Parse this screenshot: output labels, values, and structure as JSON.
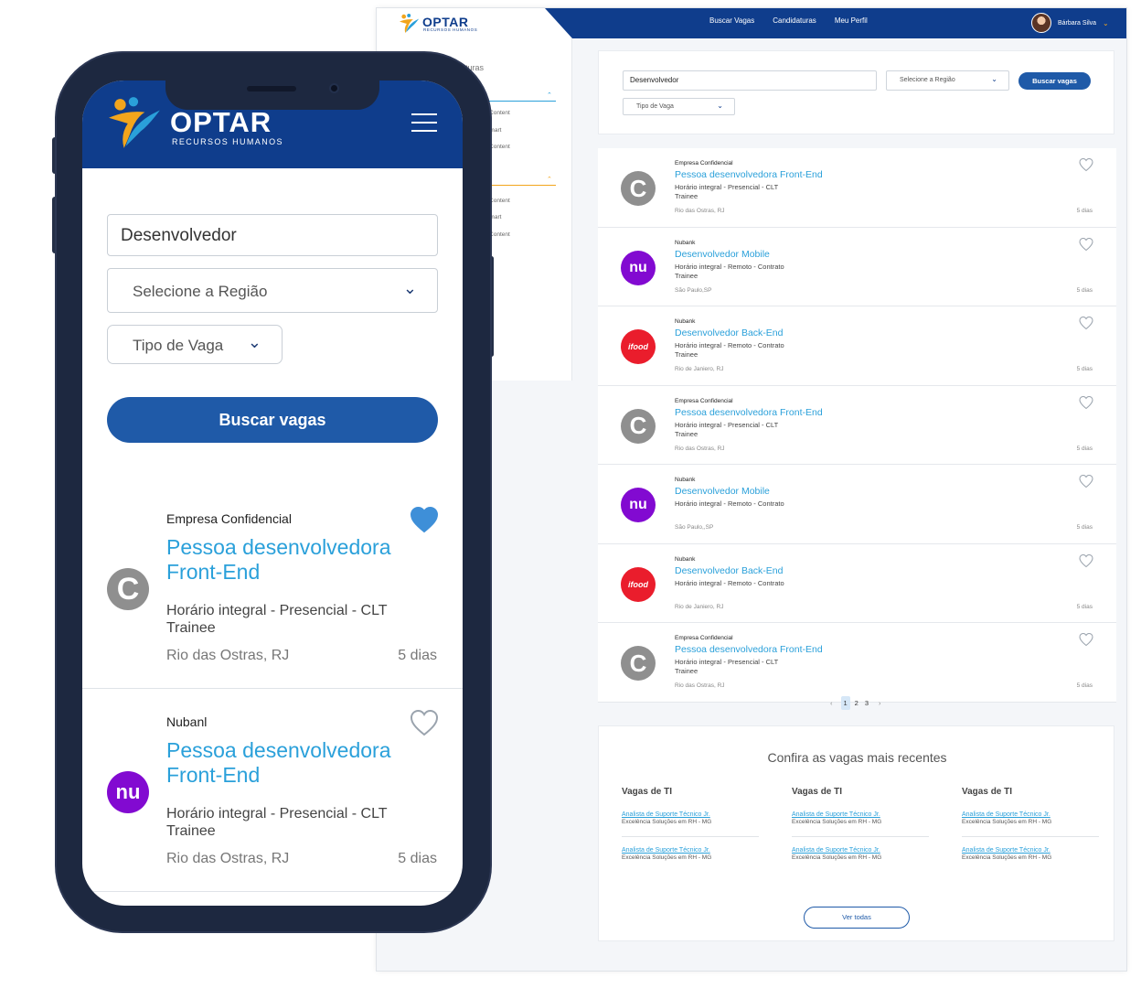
{
  "colors": {
    "brand": "#0f3d8c",
    "button": "#1f5aa8",
    "link": "#2aa0da",
    "accent": "#f2a51c",
    "nubank": "#820ad1",
    "ifood": "#ea1d2c",
    "confidential": "#8f8f8f"
  },
  "brand": {
    "name": "OPTAR",
    "tagline_mobile": "RECURSOS HUMANOS",
    "tagline_desktop": "RECURSOS HUMANOS"
  },
  "desktop": {
    "nav": [
      "Buscar Vagas",
      "Candidaturas",
      "Meu Perfil"
    ],
    "user": {
      "name": "Bárbara Silva",
      "icon": "chevron-down-icon"
    },
    "sidebar": {
      "heading": "aturas",
      "group1": [
        "k Content",
        "otmart",
        "k Content"
      ],
      "group2": [
        "k Content",
        "otmart",
        "k Content"
      ]
    },
    "search": {
      "keyword": "Desenvolvedor",
      "region": "Selecione a Região",
      "job_type": "Tipo de Vaga",
      "button": "Buscar vagas"
    },
    "jobs": [
      {
        "company": "Empresa Confidencial",
        "title": "Pessoa desenvolvedora Front-End",
        "info1": "Horário integral - Presencial - CLT",
        "info2": "Trainee",
        "location": "Rio das Ostras, RJ",
        "days": "5 dias",
        "logo": "confidential"
      },
      {
        "company": "Nubank",
        "title": "Desenvolvedor Mobile",
        "info1": "Horário integral - Remoto - Contrato",
        "info2": "Trainee",
        "location": "São Paulo,SP",
        "days": "5 dias",
        "logo": "nubank"
      },
      {
        "company": "Nubank",
        "title": "Desenvolvedor Back-End",
        "info1": "Horário integral - Remoto - Contrato",
        "info2": "Trainee",
        "location": "Rio de Janiero, RJ",
        "days": "5 dias",
        "logo": "ifood"
      },
      {
        "company": "Empresa Confidencial",
        "title": "Pessoa desenvolvedora Front-End",
        "info1": "Horário integral - Presencial - CLT",
        "info2": "Trainee",
        "location": "Rio das Ostras, RJ",
        "days": "5 dias",
        "logo": "confidential"
      },
      {
        "company": "Nubank",
        "title": "Desenvolvedor Mobile",
        "info1": "Horário integral - Remoto - Contrato",
        "info2": "",
        "location": "São Paulo,,SP",
        "days": "5 dias",
        "logo": "nubank"
      },
      {
        "company": "Nubank",
        "title": "Desenvolvedor Back-End",
        "info1": "Horário integral - Remoto - Contrato",
        "info2": "",
        "location": "Rio de Janiero, RJ",
        "days": "5 dias",
        "logo": "ifood"
      },
      {
        "company": "Empresa Confidencial",
        "title": "Pessoa desenvolvedora Front-End",
        "info1": "Horário integral - Presencial - CLT",
        "info2": "Trainee",
        "location": "Rio das Ostras, RJ",
        "days": "5 dias",
        "logo": "confidential"
      }
    ],
    "pagination": {
      "prev": "‹",
      "pages": [
        "1",
        "2",
        "3"
      ],
      "current": "1",
      "next": "›"
    },
    "recent": {
      "title": "Confira as vagas mais recentes",
      "columns": [
        {
          "title": "Vagas de TI",
          "items": [
            {
              "title": "Analista de Suporte Técnico Jr.",
              "company": "Excelência Soluções em RH - MG"
            },
            {
              "title": "Analista de Suporte Técnico Jr.",
              "company": "Excelência Soluções em RH - MG"
            }
          ]
        },
        {
          "title": "Vagas de TI",
          "items": [
            {
              "title": "Analista de Suporte Técnico Jr.",
              "company": "Excelência Soluções em RH - MG"
            },
            {
              "title": "Analista de Suporte Técnico Jr.",
              "company": "Excelência Soluções em RH - MG"
            }
          ]
        },
        {
          "title": "Vagas de TI",
          "items": [
            {
              "title": "Analista de Suporte Técnico Jr.",
              "company": "Excelência Soluções em RH - MG"
            },
            {
              "title": "Analista de Suporte Técnico Jr.",
              "company": "Excelência Soluções em RH - MG"
            }
          ]
        }
      ],
      "button": "Ver todas"
    }
  },
  "mobile": {
    "search": {
      "keyword": "Desenvolvedor",
      "region": "Selecione a Região",
      "job_type": "Tipo de Vaga",
      "button": "Buscar vagas"
    },
    "jobs": [
      {
        "company": "Empresa Confidencial",
        "title": "Pessoa desenvolvedora Front-End",
        "info1": "Horário integral - Presencial - CLT",
        "info2": "Trainee",
        "location": "Rio das Ostras, RJ",
        "days": "5 dias",
        "logo": "confidential",
        "favorited": true
      },
      {
        "company": "Nubanl",
        "title": "Pessoa desenvolvedora Front-End",
        "info1": "Horário integral - Presencial - CLT",
        "info2": "Trainee",
        "location": "Rio das Ostras, RJ",
        "days": "5 dias",
        "logo": "nubank",
        "favorited": false
      }
    ]
  },
  "logo_text": {
    "nubank": "nu",
    "ifood": "ifood",
    "confidential": "C"
  }
}
